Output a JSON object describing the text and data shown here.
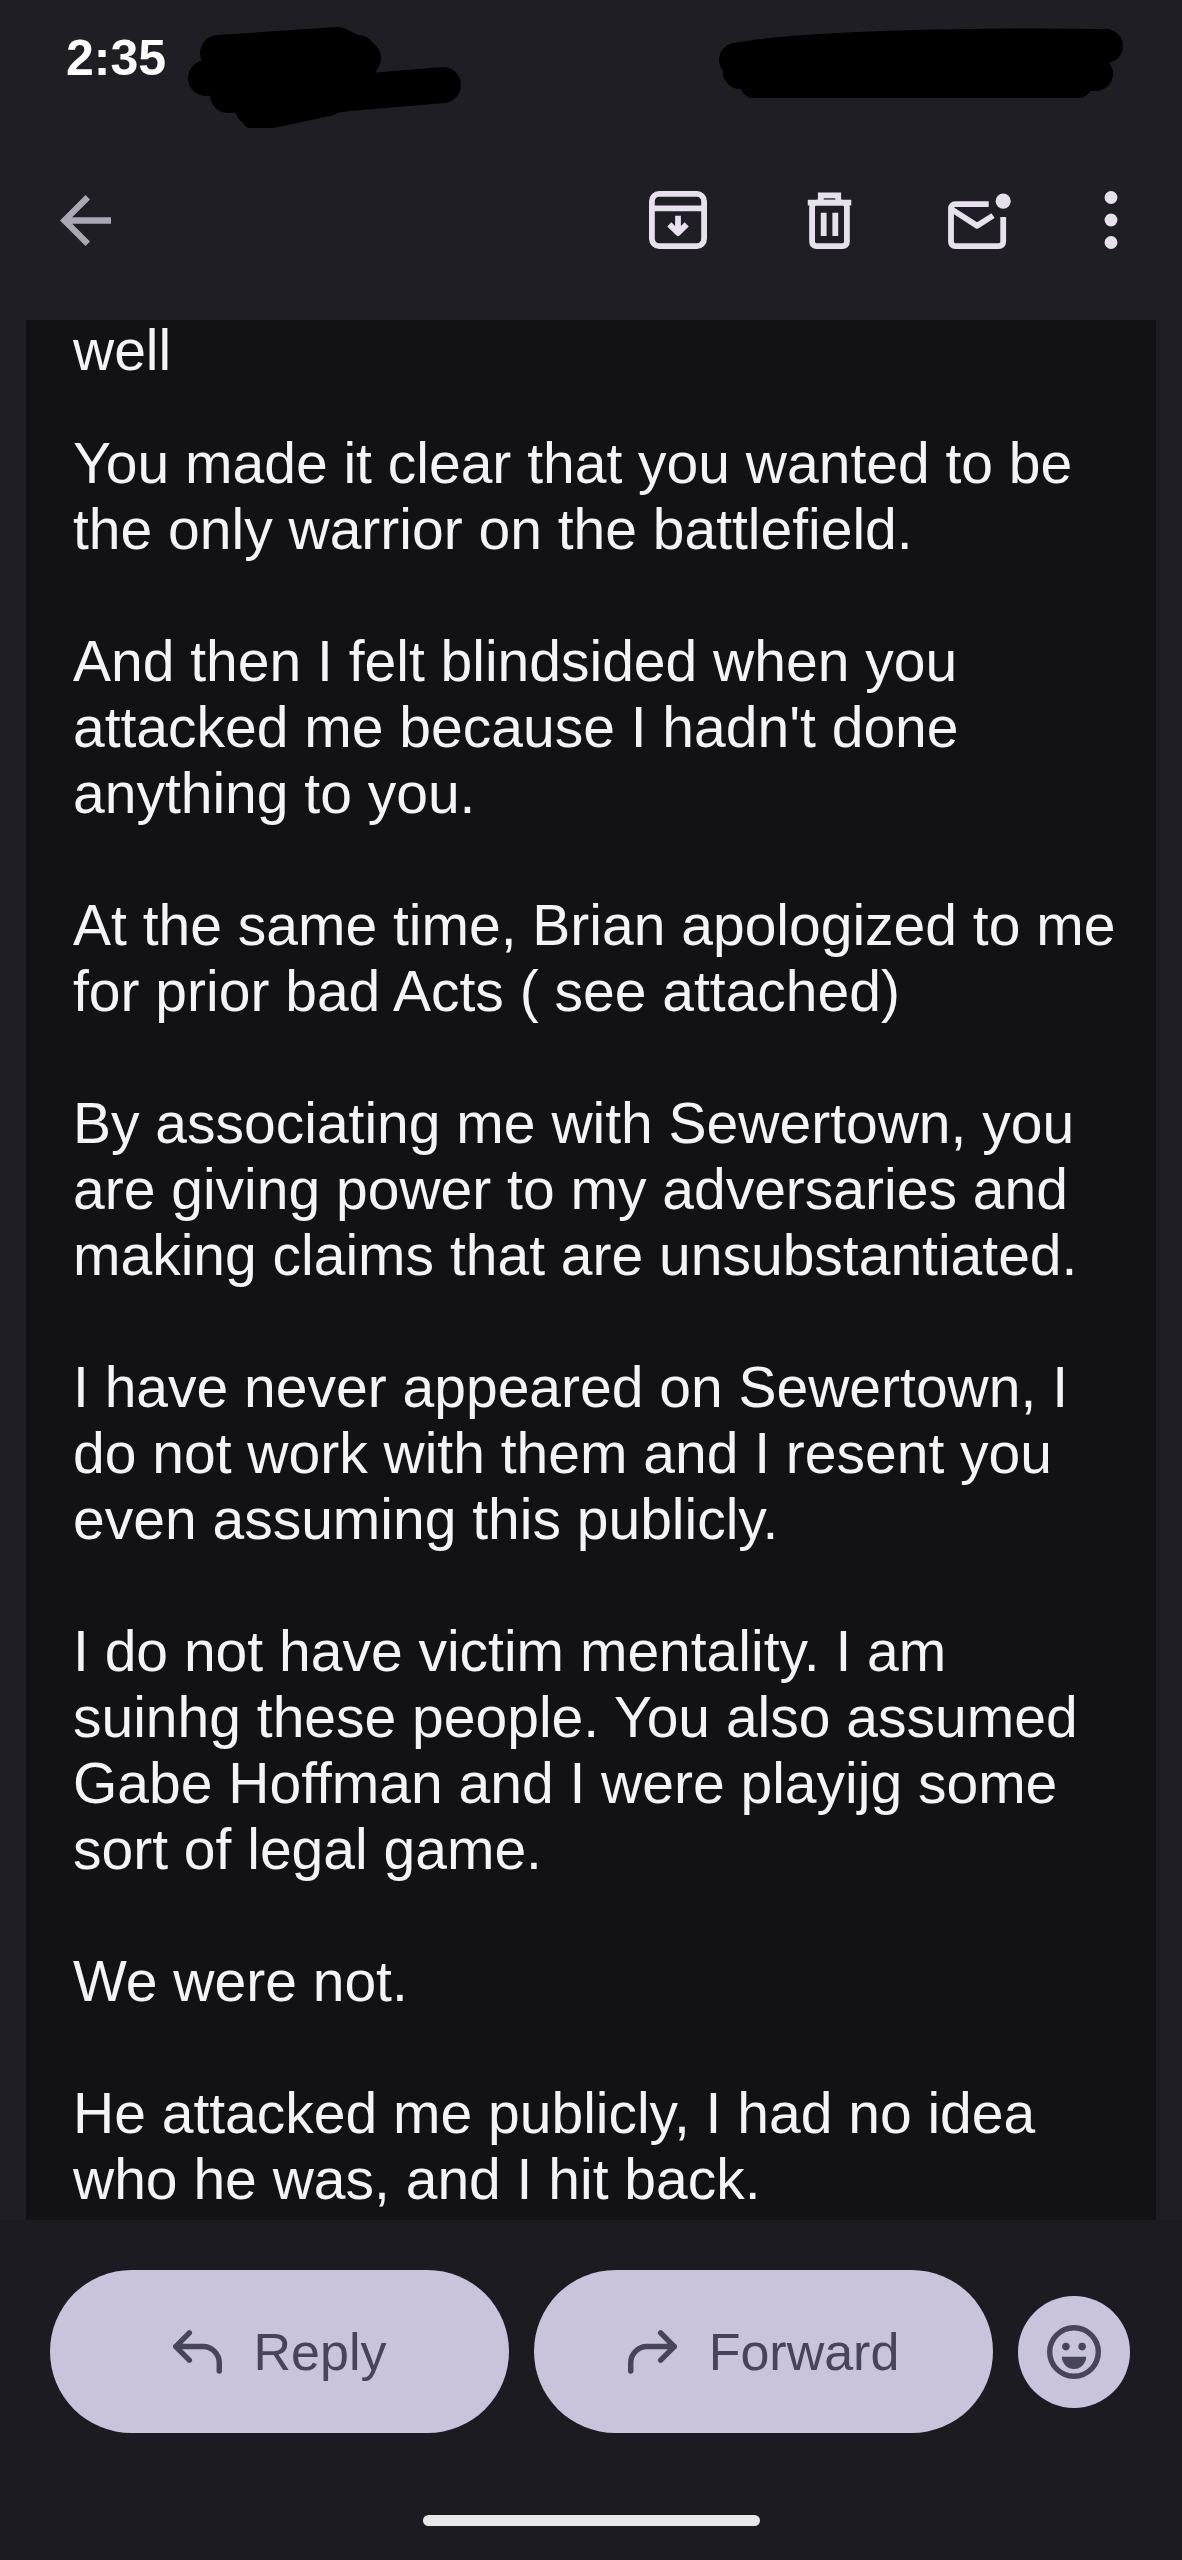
{
  "status_bar": {
    "time": "2:35"
  },
  "message_body": {
    "paragraphs": [
      {
        "lines": [
          "well"
        ]
      },
      {
        "lines": [
          "You made it clear that you wanted to be",
          "the only warrior on the battlefield."
        ]
      },
      {
        "lines": [
          "And then I felt blindsided when you",
          "attacked me because I hadn't done",
          "anything to you."
        ]
      },
      {
        "lines": [
          "At the same time, Brian apologized to me",
          "for prior bad Acts ( see attached)"
        ]
      },
      {
        "lines": [
          "By associating me with Sewertown, you",
          "are giving power to my adversaries and",
          "making claims that are unsubstantiated."
        ]
      },
      {
        "lines": [
          "I have never appeared on Sewertown, I",
          "do not work with them and I resent you",
          "even assuming this publicly."
        ]
      },
      {
        "lines": [
          "I do not have victim mentality. I am",
          "suinhg these people. You also assumed",
          "Gabe Hoffman and I were playijg some",
          "sort of legal game."
        ]
      },
      {
        "lines": [
          "We were not."
        ]
      },
      {
        "lines": [
          "He attacked me publicly, I had no idea",
          "who he was, and I hit back."
        ]
      }
    ]
  },
  "action_bar": {
    "buttons": [
      {
        "kind": "reply",
        "label": "Reply"
      },
      {
        "kind": "forward",
        "label": "Forward"
      }
    ]
  }
}
